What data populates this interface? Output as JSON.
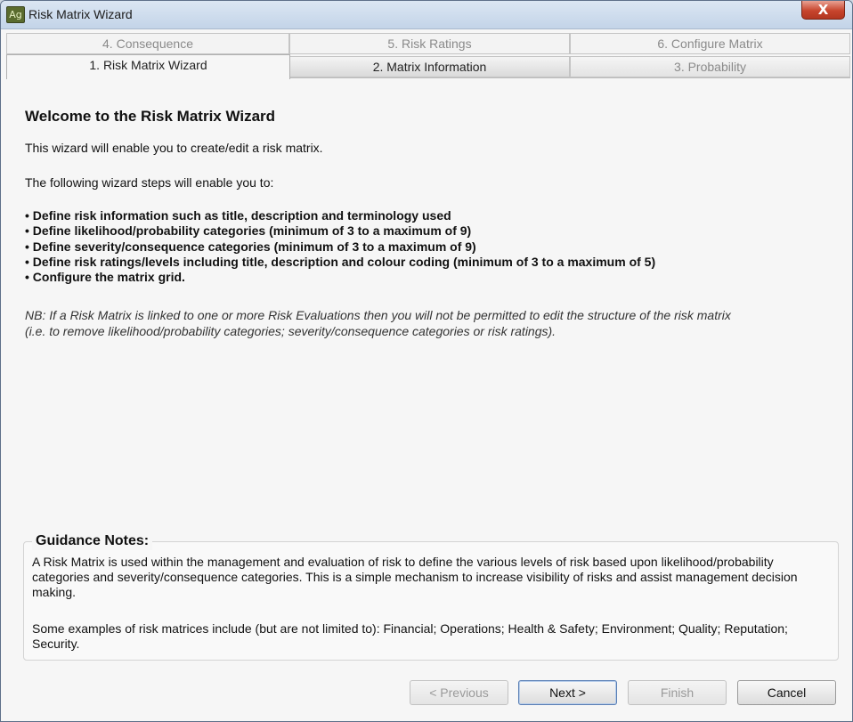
{
  "window": {
    "app_icon_text": "Ag",
    "title": "Risk Matrix Wizard",
    "close_glyph": "X"
  },
  "tabs": {
    "top_row": [
      {
        "label": "4. Consequence",
        "state": "disabled"
      },
      {
        "label": "5. Risk Ratings",
        "state": "disabled"
      },
      {
        "label": "6. Configure Matrix",
        "state": "disabled"
      }
    ],
    "bottom_row": [
      {
        "label": "1. Risk Matrix Wizard",
        "state": "active"
      },
      {
        "label": "2. Matrix Information",
        "state": "enabled"
      },
      {
        "label": "3. Probability",
        "state": "disabled"
      }
    ]
  },
  "main": {
    "heading": "Welcome to the Risk Matrix Wizard",
    "intro": "This wizard will enable you to create/edit a risk matrix.",
    "steps_intro": "The following wizard steps will enable you to:",
    "bullets": [
      "• Define risk information such as title, description and terminology used",
      "• Define likelihood/probability categories (minimum of 3 to a maximum of 9)",
      "• Define severity/consequence categories (minimum of 3 to a maximum of 9)",
      "• Define risk ratings/levels including title, description and colour coding (minimum of 3 to a maximum of 5)",
      "• Configure the matrix grid."
    ],
    "note_line1": "NB: If a Risk Matrix is linked to one or more Risk Evaluations then you will not be permitted to edit the structure of the risk matrix",
    "note_line2": "(i.e. to remove likelihood/probability categories; severity/consequence categories or risk ratings)."
  },
  "guidance": {
    "title": "Guidance Notes:",
    "paragraph1": "A Risk Matrix is used within the management and evaluation of risk to define the various levels of risk based upon likelihood/probability categories and severity/consequence categories. This is a simple mechanism to increase visibility of risks and assist management decision making.",
    "paragraph2": "Some examples of risk matrices include (but are not limited to): Financial; Operations; Health & Safety; Environment; Quality; Reputation; Security."
  },
  "buttons": {
    "previous": {
      "label": "< Previous",
      "enabled": false
    },
    "next": {
      "label": "Next >",
      "enabled": true
    },
    "finish": {
      "label": "Finish",
      "enabled": false
    },
    "cancel": {
      "label": "Cancel",
      "enabled": true
    }
  },
  "colors": {
    "title_bar": "#c9d9ec",
    "close_button": "#c7452d",
    "window_bg": "#f6f6f6"
  }
}
